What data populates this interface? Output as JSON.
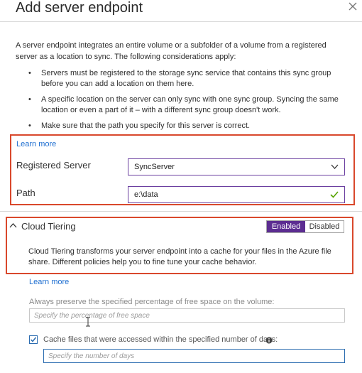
{
  "title": "Add server endpoint",
  "intro": "A server endpoint integrates an entire volume or a subfolder of a volume from a registered server as a location to sync. The following considerations apply:",
  "bullets": [
    "Servers must be registered to the storage sync service that contains this sync group before you can add a location on them here.",
    "A specific location on the server can only sync with one sync group. Syncing the same location or even a part of it – with a different sync group doesn't work.",
    "Make sure that the path you specify for this server is correct."
  ],
  "learn_more_1": "Learn more",
  "registered_server": {
    "label": "Registered Server",
    "value": "SyncServer"
  },
  "path": {
    "label": "Path",
    "value": "e:\\data"
  },
  "cloud_tiering": {
    "label": "Cloud Tiering",
    "toggle": {
      "enabled": "Enabled",
      "disabled": "Disabled"
    },
    "description": "Cloud Tiering transforms your server endpoint into a cache for your files in the Azure file share. Different policies help you to fine tune your cache behavior."
  },
  "learn_more_2": "Learn more",
  "free_space": {
    "label": "Always preserve the specified percentage of free space on the volume:",
    "placeholder": "Specify the percentage of free space"
  },
  "cache_days": {
    "label": "Cache files that were accessed within the specified number of days:",
    "placeholder": "Specify the number of days",
    "checked": true
  },
  "colors": {
    "accent_purple": "#5c2d91",
    "highlight_red": "#d9482c",
    "link_blue": "#1f6fd1"
  }
}
